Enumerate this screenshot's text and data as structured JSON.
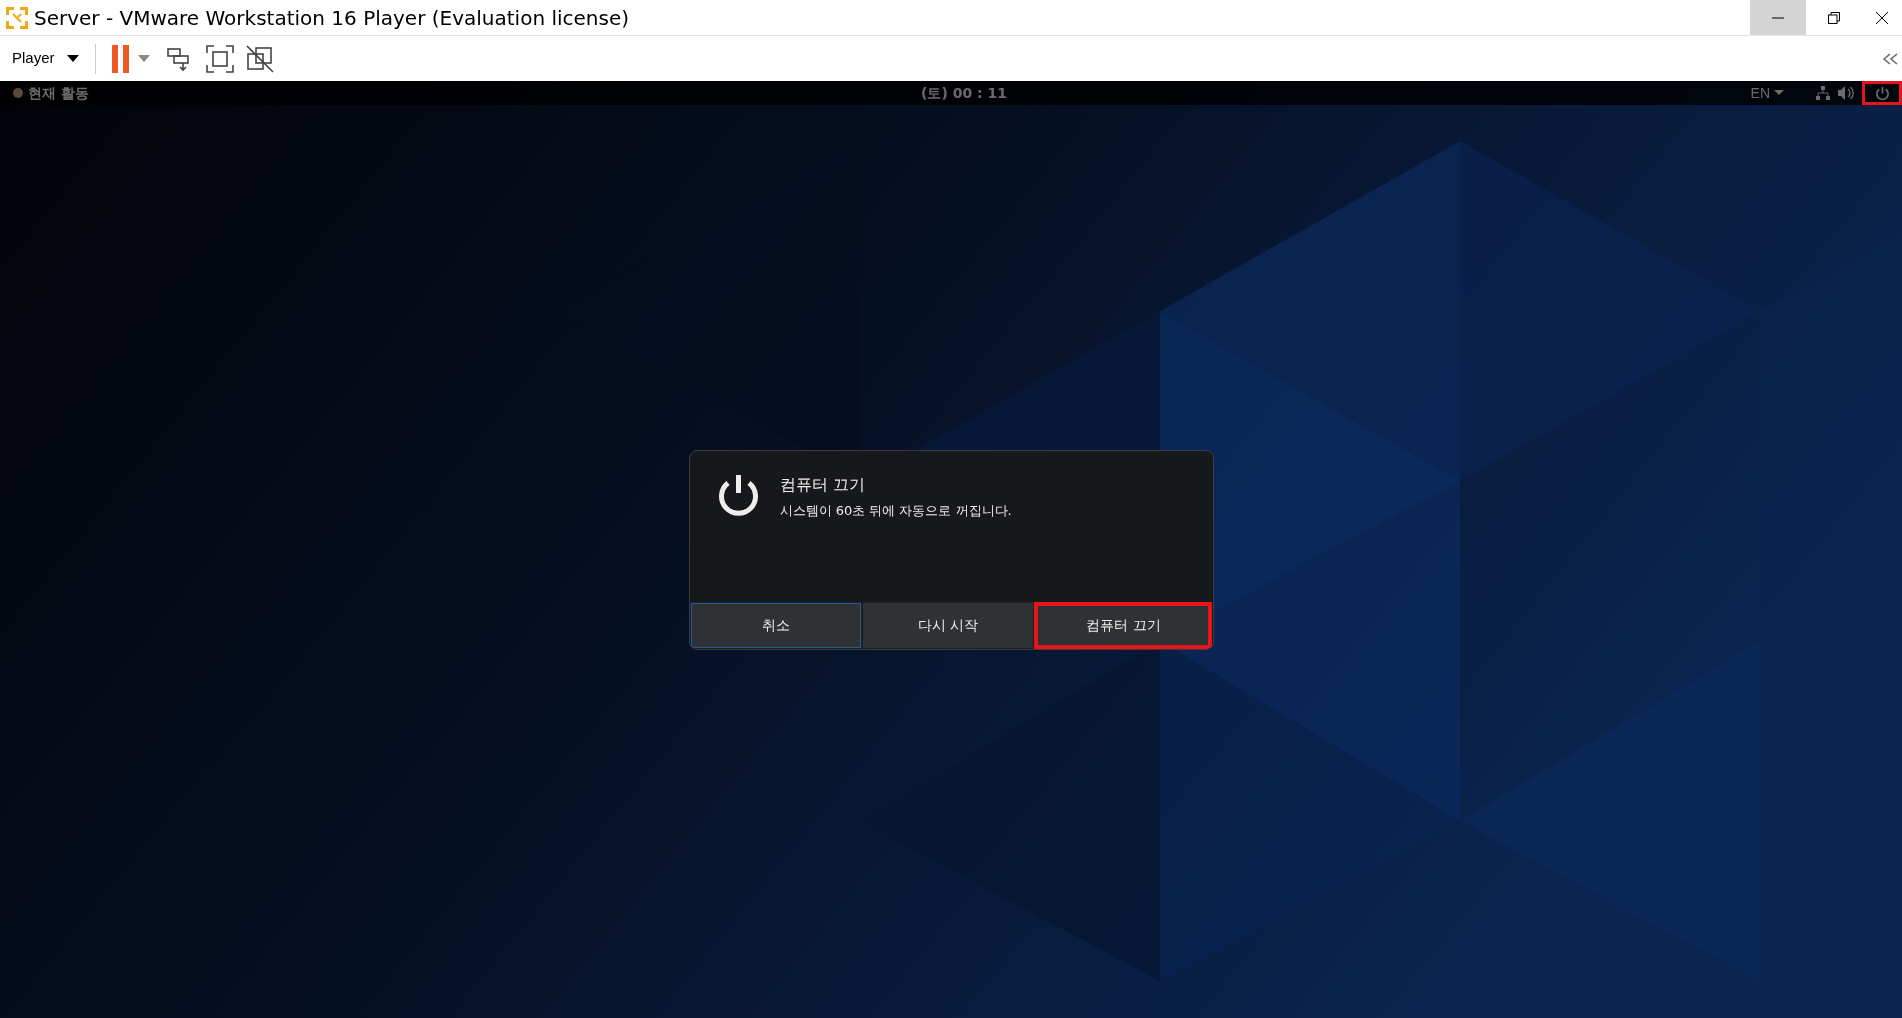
{
  "window": {
    "title": "Server - VMware Workstation 16 Player (Evaluation license)"
  },
  "toolbar": {
    "player_menu": "Player"
  },
  "top_bar": {
    "activities": "현재 활동",
    "clock": "(토) 00 : 11",
    "input_source": "EN",
    "power_menu_highlighted": true
  },
  "dialog": {
    "title": "컴퓨터 끄기",
    "message": "시스템이 60초 뒤에 자동으로 꺼집니다.",
    "buttons": [
      {
        "label": "취소",
        "focused": true,
        "highlighted": false
      },
      {
        "label": "다시 시작",
        "focused": false,
        "highlighted": false
      },
      {
        "label": "컴퓨터 끄기",
        "focused": false,
        "highlighted": true
      }
    ]
  }
}
